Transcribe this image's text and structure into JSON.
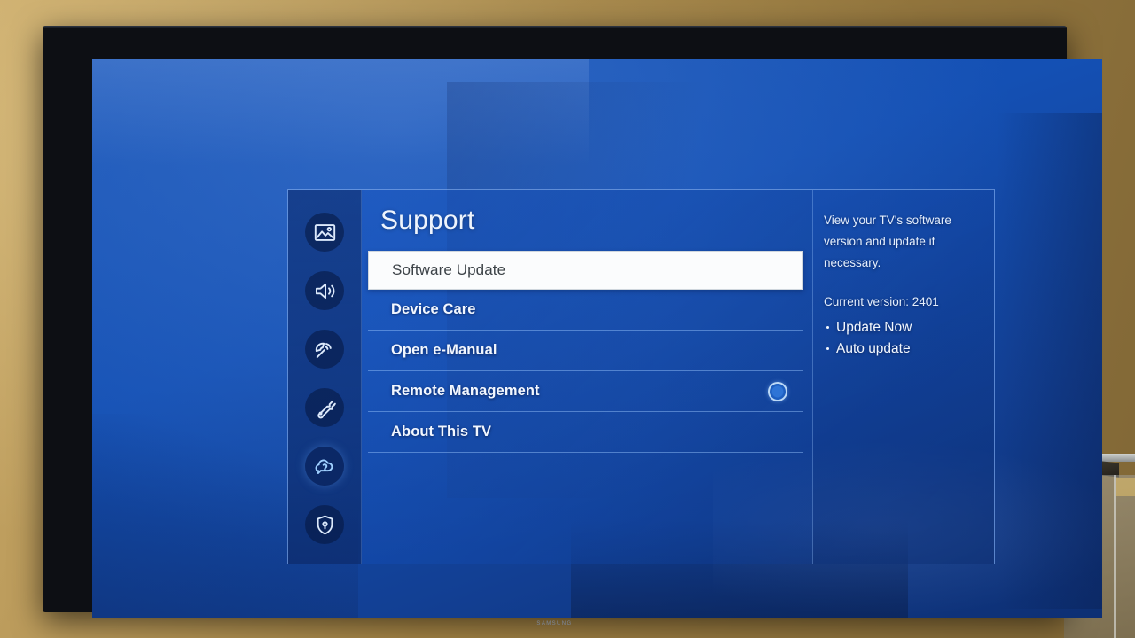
{
  "tv": {
    "brand_logo": "SAMSUNG"
  },
  "menu": {
    "title": "Support",
    "sidebar": {
      "items": [
        {
          "icon": "picture-icon",
          "name": "picture",
          "active": false
        },
        {
          "icon": "sound-icon",
          "name": "sound",
          "active": false
        },
        {
          "icon": "broadcast-icon",
          "name": "broadcast",
          "active": false
        },
        {
          "icon": "wrench-icon",
          "name": "general",
          "active": false
        },
        {
          "icon": "support-help-icon",
          "name": "support",
          "active": true
        },
        {
          "icon": "shield-lock-icon",
          "name": "privacy",
          "active": false
        }
      ]
    },
    "items": [
      {
        "label": "Software Update",
        "selected": true,
        "toggle": false
      },
      {
        "label": "Device Care",
        "selected": false,
        "toggle": false
      },
      {
        "label": "Open e-Manual",
        "selected": false,
        "toggle": false
      },
      {
        "label": "Remote Management",
        "selected": false,
        "toggle": true
      },
      {
        "label": "About This TV",
        "selected": false,
        "toggle": false
      }
    ],
    "info": {
      "description": "View your TV's software version and update if necessary.",
      "version_line": "Current version: 2401",
      "actions": [
        "Update Now",
        "Auto update"
      ]
    }
  },
  "colors": {
    "screen_blue": "#1450b4",
    "selected_row_bg": "#fbfcfd",
    "selected_row_text": "#3d4348",
    "menu_text": "#f2f7ff",
    "accent_ring": "#bcd9f7",
    "wall_gold": "#b08f4e"
  }
}
